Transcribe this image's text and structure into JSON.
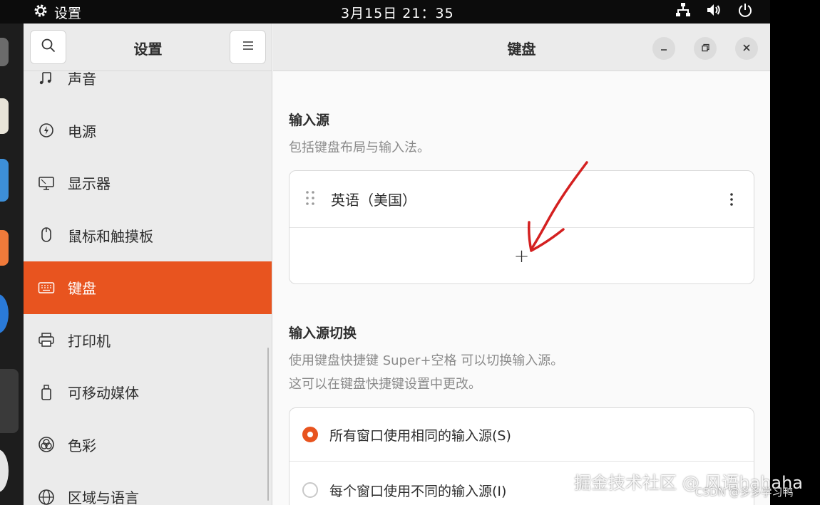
{
  "topbar": {
    "app_name": "设置",
    "clock": "3月15日 21：35",
    "tray_icons": [
      "network-icon",
      "volume-icon",
      "power-icon"
    ]
  },
  "sidebar": {
    "title": "设置",
    "search_icon": "search-icon",
    "menu_icon": "hamburger-menu-icon",
    "items": [
      {
        "label": "声音",
        "icon": "music-note-icon"
      },
      {
        "label": "电源",
        "icon": "power-bolt-icon"
      },
      {
        "label": "显示器",
        "icon": "monitor-icon"
      },
      {
        "label": "鼠标和触摸板",
        "icon": "mouse-icon"
      },
      {
        "label": "键盘",
        "icon": "keyboard-icon",
        "active": true
      },
      {
        "label": "打印机",
        "icon": "printer-icon"
      },
      {
        "label": "可移动媒体",
        "icon": "usb-drive-icon"
      },
      {
        "label": "色彩",
        "icon": "color-icon"
      },
      {
        "label": "区域与语言",
        "icon": "globe-icon"
      }
    ]
  },
  "main": {
    "title": "键盘",
    "input_sources": {
      "title": "输入源",
      "description": "包括键盘布局与输入法。",
      "sources": [
        {
          "label": "英语（美国）"
        }
      ],
      "add_symbol": "+"
    },
    "switching": {
      "title": "输入源切换",
      "description_line1": "使用键盘快捷键 Super+空格 可以切换输入源。",
      "description_line2": "这可以在键盘快捷键设置中更改。",
      "options": [
        {
          "label": "所有窗口使用相同的输入源(S)",
          "selected": true
        },
        {
          "label": "每个窗口使用不同的输入源(I)",
          "selected": false
        }
      ]
    }
  },
  "colors": {
    "accent": "#e8541f",
    "annotation": "#d42020"
  },
  "watermark": {
    "line1": "掘金技术社区 @ 风语hahaha",
    "line2": "CSDN @多多学习鸭"
  }
}
